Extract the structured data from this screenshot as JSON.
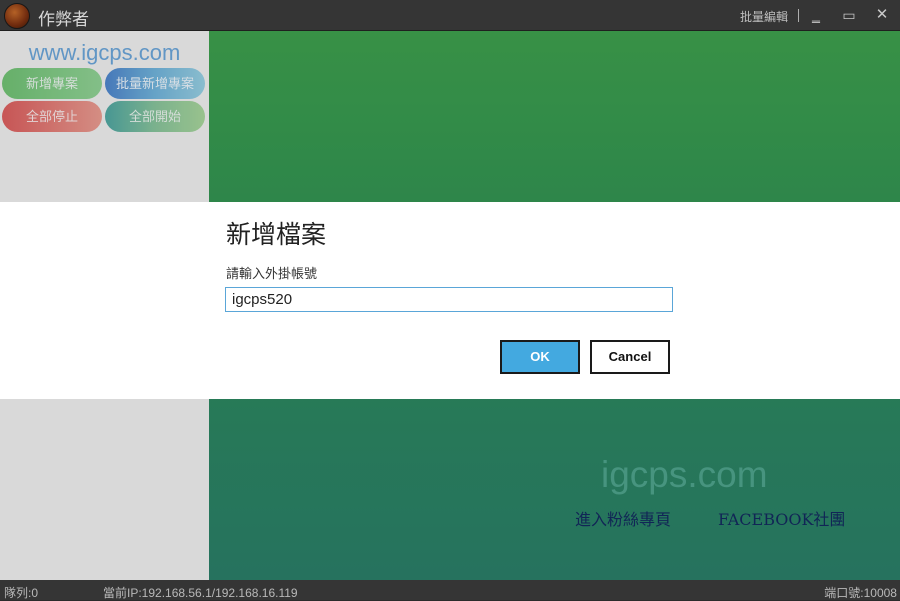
{
  "window": {
    "title": "作弊者",
    "link_label": "批量編輯",
    "minimize_glyph": "‗",
    "maximize_glyph": "▭",
    "close_glyph": "✕"
  },
  "sidebar": {
    "site_url": "www.igcps.com",
    "buttons": {
      "add": "新增專案",
      "batch_add": "批量新增專案",
      "stop_all": "全部停止",
      "start_all": "全部開始"
    }
  },
  "main": {
    "watermark": "igcps.com",
    "fans_link": "進入粉絲專頁",
    "facebook_link": "FACEBOOK社團"
  },
  "statusbar": {
    "queue": "隊列:0",
    "current_ip": "當前IP:192.168.56.1/192.168.16.119",
    "port": "端口號:10008"
  },
  "dialog": {
    "title": "新增檔案",
    "label": "請輸入外掛帳號",
    "input_value": "igcps520",
    "ok_label": "OK",
    "cancel_label": "Cancel"
  },
  "colors": {
    "accent_ok": "#43a9e0",
    "main_green": "#3d9e4d",
    "teal": "#2a7c66",
    "input_border": "#5aa6d8"
  }
}
